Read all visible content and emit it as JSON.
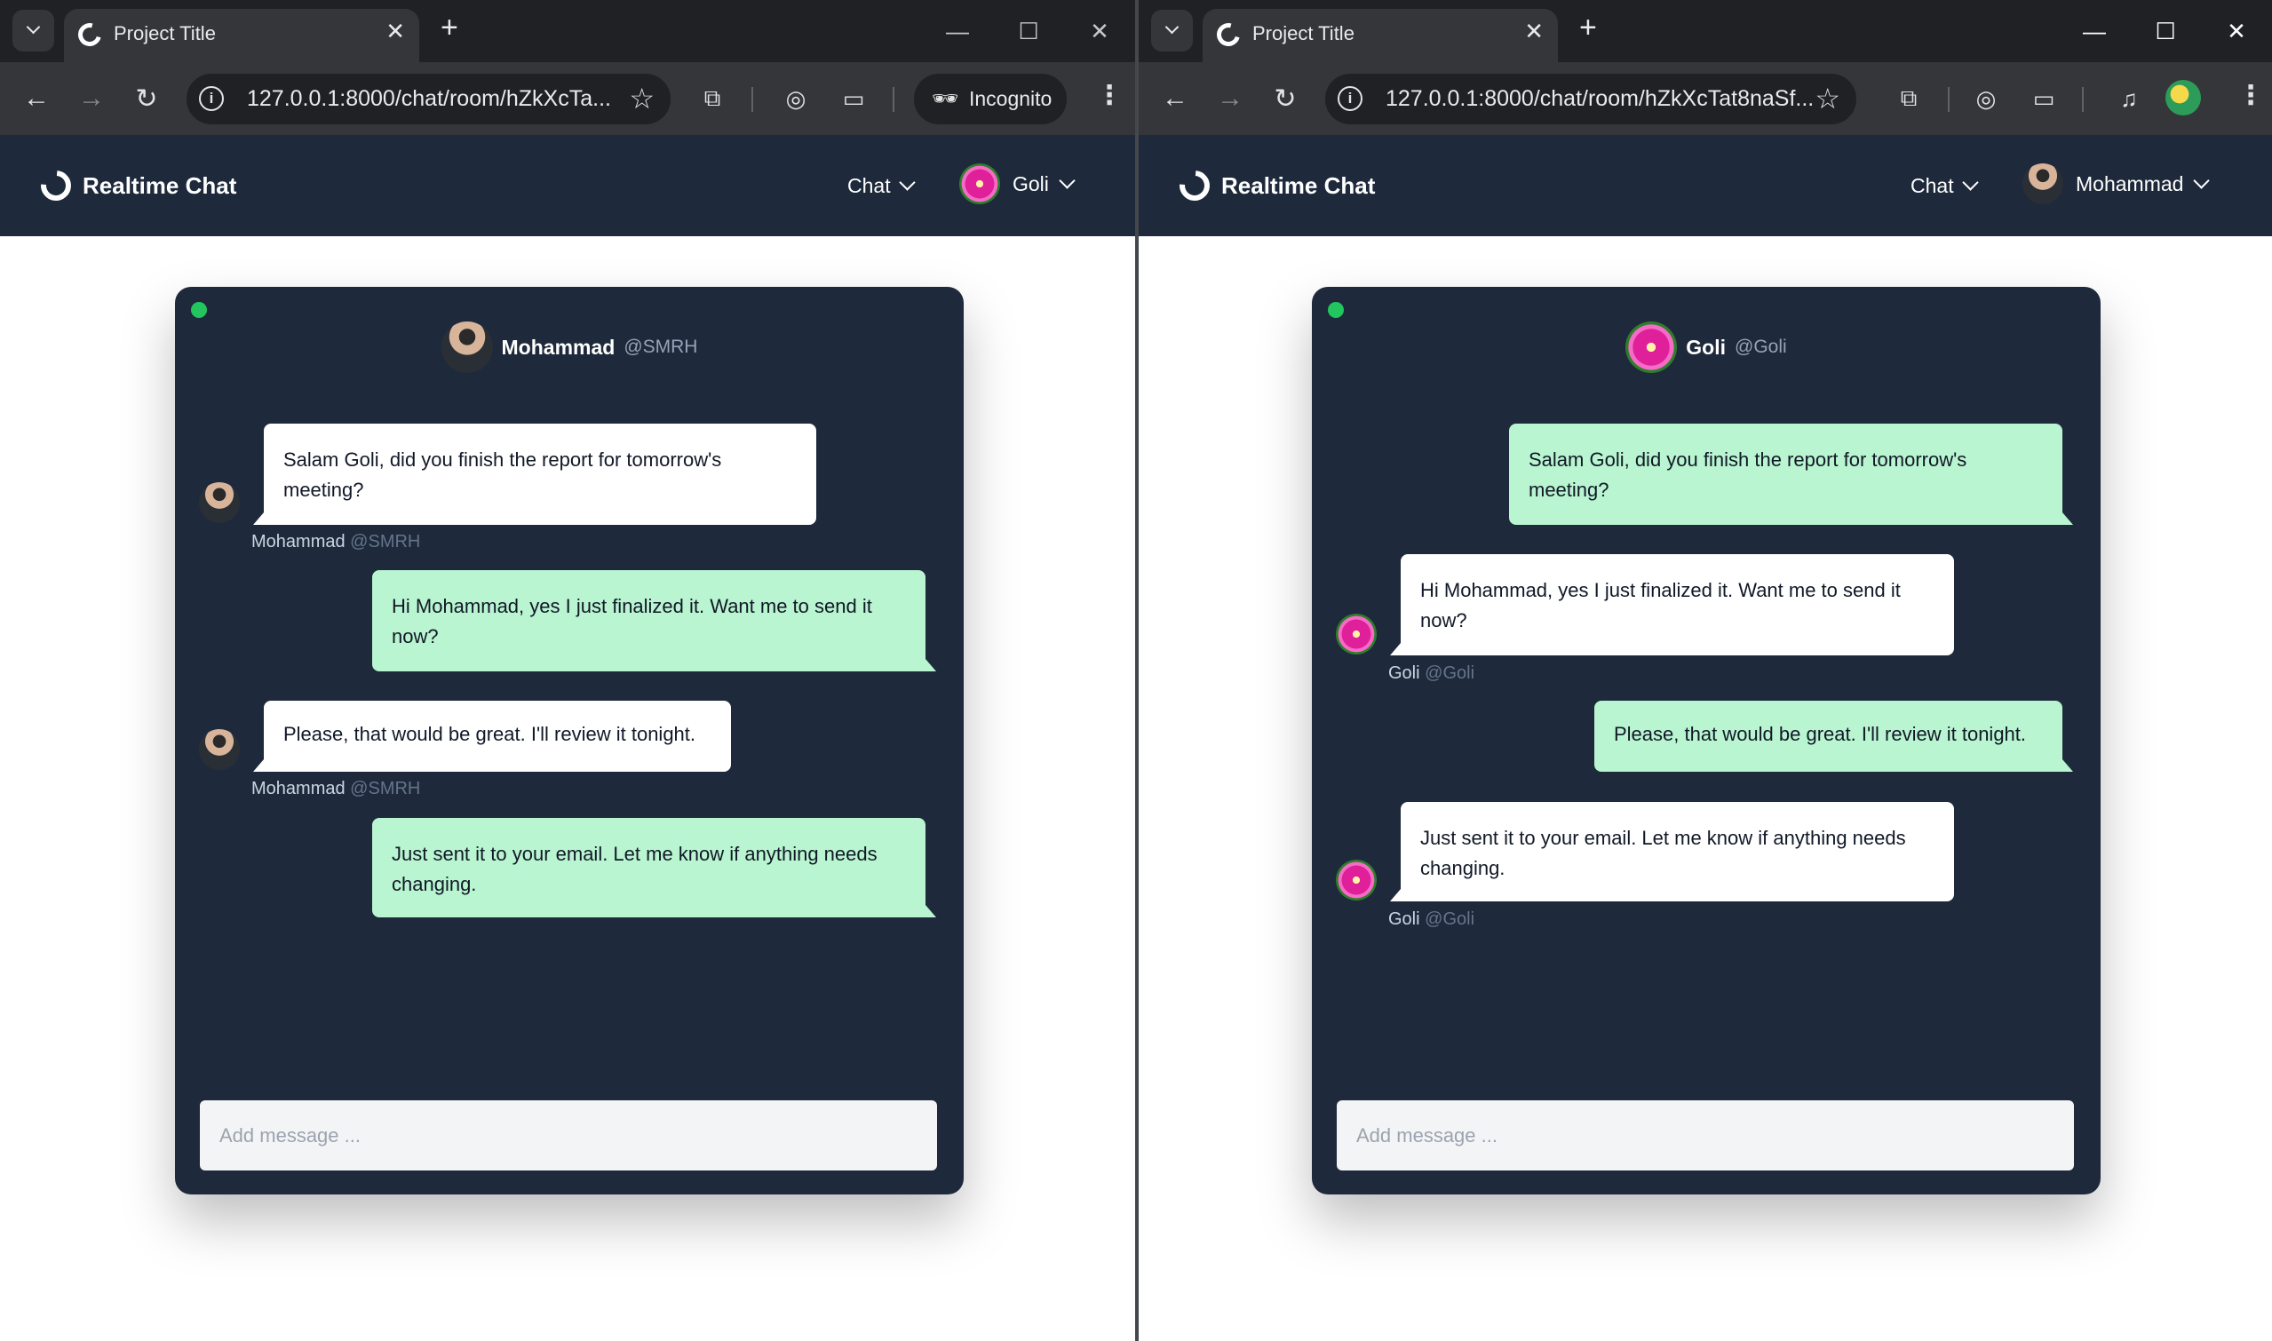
{
  "windows": [
    {
      "tab_title": "Project Title",
      "url": "127.0.0.1:8000/chat/room/hZkXcTa...",
      "incognito_label": "Incognito",
      "nav_brand": "Realtime Chat",
      "nav_chat_label": "Chat",
      "nav_user_name": "Goli",
      "chat_partner": {
        "name": "Mohammad",
        "handle": "@SMRH"
      },
      "messages": [
        {
          "text": "Salam Goli, did you finish the report for tomorrow's meeting?",
          "direction": "in",
          "author_name": "Mohammad",
          "author_handle": "@SMRH"
        },
        {
          "text": "Hi Mohammad, yes I just finalized it. Want me to send it now?",
          "direction": "out"
        },
        {
          "text": "Please, that would be great. I'll review it tonight.",
          "direction": "in",
          "author_name": "Mohammad",
          "author_handle": "@SMRH"
        },
        {
          "text": "Just sent it to your email. Let me know if anything needs changing.",
          "direction": "out"
        }
      ],
      "input_placeholder": "Add message ..."
    },
    {
      "tab_title": "Project Title",
      "url": "127.0.0.1:8000/chat/room/hZkXcTat8naSf...",
      "nav_brand": "Realtime Chat",
      "nav_chat_label": "Chat",
      "nav_user_name": "Mohammad",
      "chat_partner": {
        "name": "Goli",
        "handle": "@Goli"
      },
      "messages": [
        {
          "text": "Salam Goli, did you finish the report for tomorrow's meeting?",
          "direction": "out"
        },
        {
          "text": "Hi Mohammad, yes I just finalized it. Want me to send it now?",
          "direction": "in",
          "author_name": "Goli",
          "author_handle": "@Goli"
        },
        {
          "text": "Please, that would be great. I'll review it tonight.",
          "direction": "out"
        },
        {
          "text": "Just sent it to your email. Let me know if anything needs changing.",
          "direction": "in",
          "author_name": "Goli",
          "author_handle": "@Goli"
        }
      ],
      "input_placeholder": "Add message ..."
    }
  ],
  "colors": {
    "nav_bg": "#1e293b",
    "card_bg": "#1e293b",
    "outgoing_bubble": "#b9f5d0",
    "incoming_bubble": "#ffffff",
    "online_dot": "#22c55e"
  }
}
